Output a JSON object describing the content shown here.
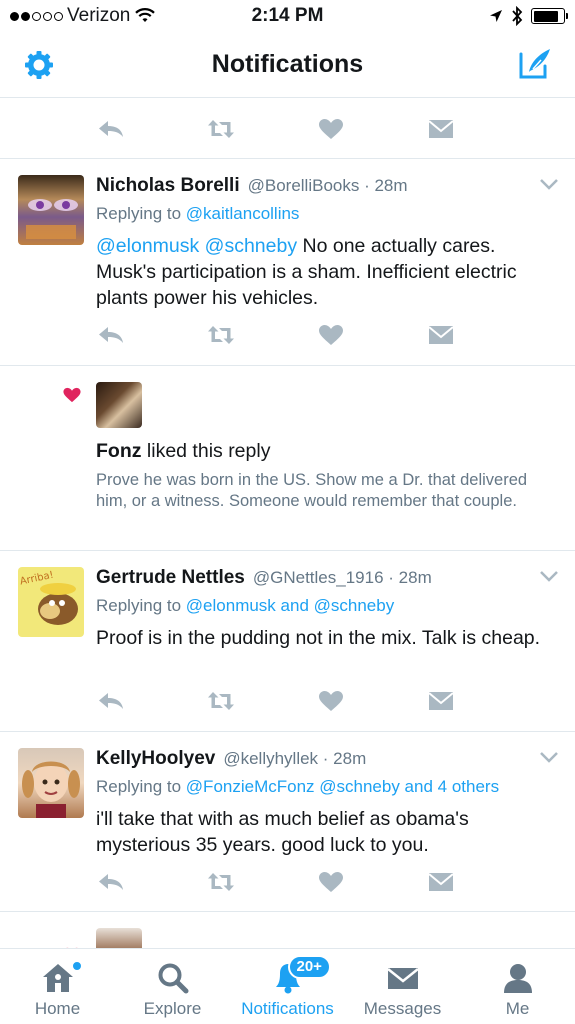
{
  "status_bar": {
    "carrier": "Verizon",
    "time": "2:14 PM",
    "signal_bars_filled": 2,
    "signal_bars_total": 5,
    "battery_level": 0.85
  },
  "header": {
    "title": "Notifications",
    "settings_icon": "gear-icon",
    "compose_icon": "compose-icon"
  },
  "colors": {
    "accent": "#1da1f2",
    "action_gray": "#aab8c2",
    "text_gray": "#657786",
    "like_pink": "#e0245e"
  },
  "tweets": [
    {
      "name": "Nicholas Borelli",
      "handle": "@BorelliBooks",
      "time": "· 28m",
      "replying_prefix": "Replying to",
      "replying_to": "@kaitlancollins",
      "mentions": "@elonmusk @schneby",
      "text": "No one actually cares. Musk's participation is a sham. Inefficient electric plants power his vehicles."
    },
    {
      "name": "Gertrude Nettles",
      "handle": "@GNettles_1916",
      "time": "· 28m",
      "replying_prefix": "Replying to",
      "replying_to": "@elonmusk and @schneby",
      "mentions": "",
      "text": "Proof is in the pudding not in the mix. Talk is cheap."
    },
    {
      "name": "KellyHoolyev",
      "handle": "@kellyhyllek",
      "time": "· 28m",
      "replying_prefix": "Replying to",
      "replying_to": "@FonzieMcFonz @schneby and 4 others",
      "mentions": "",
      "text": "i'll take that with as much belief as obama's mysterious 35 years. good luck to you."
    }
  ],
  "like_notification": {
    "user": "Fonz",
    "action": "liked this reply",
    "text": "Prove he was born in the US.  Show me a Dr. that delivered him, or a witness.  Someone would remember that couple."
  },
  "tabs": [
    {
      "label": "Home",
      "icon": "home-icon",
      "active": false
    },
    {
      "label": "Explore",
      "icon": "search-icon",
      "active": false
    },
    {
      "label": "Notifications",
      "icon": "bell-icon",
      "active": true,
      "badge": "20+"
    },
    {
      "label": "Messages",
      "icon": "envelope-icon",
      "active": false
    },
    {
      "label": "Me",
      "icon": "person-icon",
      "active": false
    }
  ]
}
